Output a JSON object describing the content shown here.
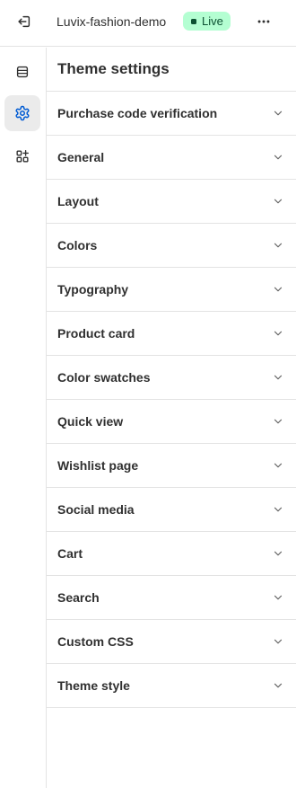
{
  "header": {
    "exit_icon": "exit-icon",
    "store_name": "Luvix-fashion-demo",
    "status": "Live",
    "status_color": "#b4fed2",
    "more_icon": "more-horizontal-icon"
  },
  "rail": {
    "items": [
      {
        "icon": "sections-icon",
        "active": false
      },
      {
        "icon": "settings-gear-icon",
        "active": true,
        "color": "#005bd3"
      },
      {
        "icon": "apps-icon",
        "active": false
      }
    ]
  },
  "panel": {
    "title": "Theme settings",
    "sections": [
      {
        "label": "Purchase code verification"
      },
      {
        "label": "General"
      },
      {
        "label": "Layout"
      },
      {
        "label": "Colors"
      },
      {
        "label": "Typography"
      },
      {
        "label": "Product card"
      },
      {
        "label": "Color swatches"
      },
      {
        "label": "Quick view"
      },
      {
        "label": "Wishlist page"
      },
      {
        "label": "Social media"
      },
      {
        "label": "Cart"
      },
      {
        "label": "Search"
      },
      {
        "label": "Custom CSS"
      },
      {
        "label": "Theme style"
      }
    ]
  }
}
